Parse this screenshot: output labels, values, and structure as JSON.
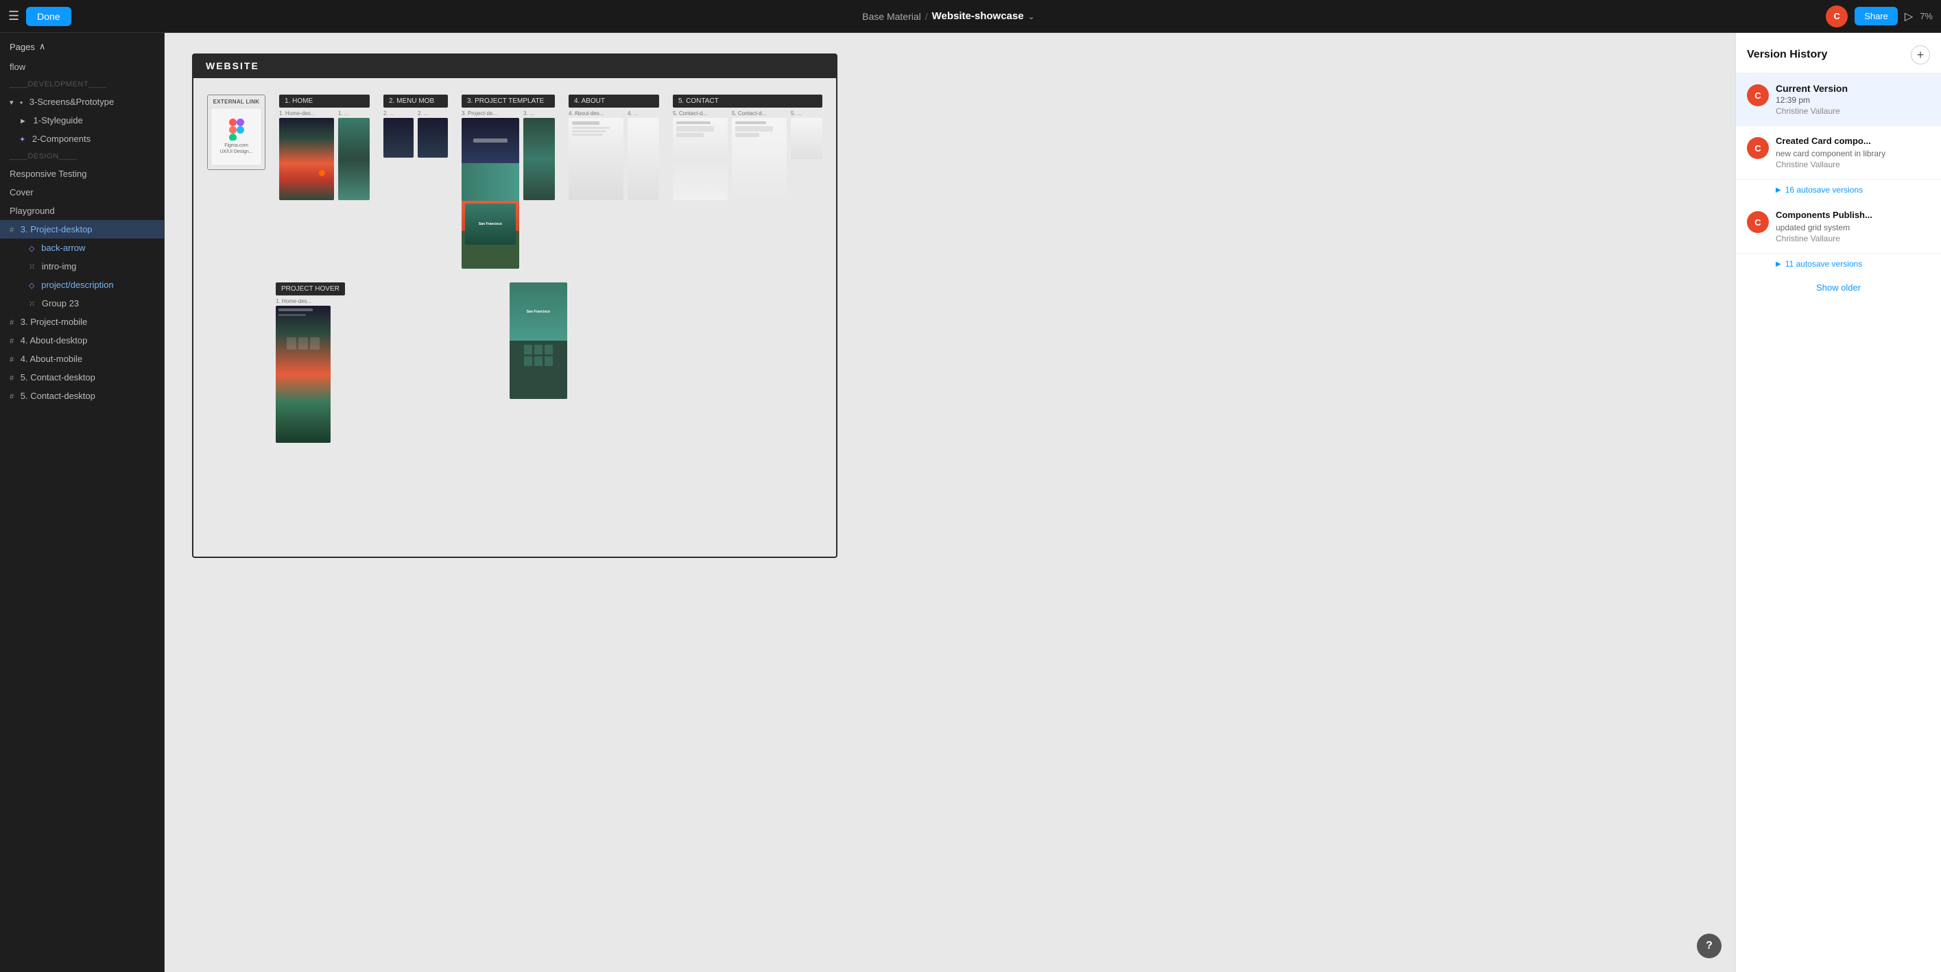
{
  "topbar": {
    "menu_icon": "☰",
    "done_label": "Done",
    "breadcrumb_base": "Base Material",
    "separator": "/",
    "file_name": "Website-showcase",
    "chevron": "⌄",
    "avatar_initials": "C",
    "share_label": "Share",
    "play_icon": "▷",
    "zoom_level": "7%"
  },
  "sidebar": {
    "pages_label": "Pages",
    "pages_chevron": "∧",
    "items": [
      {
        "id": "flow",
        "label": "flow",
        "indent": 0,
        "icon": ""
      },
      {
        "id": "development",
        "label": "____DEVELOPMENT____",
        "indent": 0,
        "icon": "",
        "is_divider": true
      },
      {
        "id": "screens-prototype",
        "label": "3-Screens&Prototype",
        "indent": 0,
        "icon": "▪",
        "expanded": true
      },
      {
        "id": "styleguide",
        "label": "1-Styleguide",
        "indent": 1,
        "icon": "►"
      },
      {
        "id": "components",
        "label": "2-Components",
        "indent": 1,
        "icon": "✦"
      },
      {
        "id": "design",
        "label": "____DESIGN____",
        "indent": 0,
        "icon": "",
        "is_divider": true
      },
      {
        "id": "responsive-testing",
        "label": "Responsive Testing",
        "indent": 0,
        "icon": ""
      },
      {
        "id": "cover",
        "label": "Cover",
        "indent": 0,
        "icon": ""
      },
      {
        "id": "playground",
        "label": "Playground",
        "indent": 0,
        "icon": ""
      },
      {
        "id": "project-desktop",
        "label": "3. Project-desktop",
        "indent": 0,
        "icon": "#",
        "active": true
      },
      {
        "id": "back-arrow",
        "label": "back-arrow",
        "indent": 1,
        "icon": "◇",
        "is_link": true
      },
      {
        "id": "intro-img",
        "label": "intro-img",
        "indent": 1,
        "icon": "⁙"
      },
      {
        "id": "project-description",
        "label": "project/description",
        "indent": 1,
        "icon": "◇",
        "is_link": true
      },
      {
        "id": "group-23",
        "label": "Group 23",
        "indent": 1,
        "icon": "⁙"
      },
      {
        "id": "project-mobile",
        "label": "3. Project-mobile",
        "indent": 0,
        "icon": "#"
      },
      {
        "id": "about-desktop",
        "label": "4. About-desktop",
        "indent": 0,
        "icon": "#"
      },
      {
        "id": "about-mobile",
        "label": "4. About-mobile",
        "indent": 0,
        "icon": "#"
      },
      {
        "id": "contact-desktop",
        "label": "5. Contact-desktop",
        "indent": 0,
        "icon": "#"
      },
      {
        "id": "contact-desktop2",
        "label": "5. Contact-desktop",
        "indent": 0,
        "icon": "#"
      }
    ]
  },
  "canvas": {
    "website_label": "WEBSITE",
    "sections": [
      {
        "id": "home",
        "num": "1.",
        "label": "HOME",
        "sub_items": [
          {
            "label": "1. Home-des...",
            "size": "tall"
          },
          {
            "label": "1. ...",
            "size": "tall-narrow"
          }
        ]
      },
      {
        "id": "menu-mob",
        "num": "2.",
        "label": "MENU MOB",
        "sub_items": [
          {
            "label": "2. ...",
            "size": "menu"
          },
          {
            "label": "2. ...",
            "size": "menu"
          }
        ]
      },
      {
        "id": "project-template",
        "num": "3.",
        "label": "PROJECT TEMPLATE",
        "sub_items": [
          {
            "label": "3. Project-de...",
            "size": "wide-tall"
          },
          {
            "label": "3. ...",
            "size": "tall-narrow"
          }
        ]
      },
      {
        "id": "about",
        "num": "4.",
        "label": "ABOUT",
        "sub_items": [
          {
            "label": "4. About-des...",
            "size": "tall"
          },
          {
            "label": "4. ...",
            "size": "tall-narrow"
          }
        ]
      },
      {
        "id": "contact",
        "num": "5.",
        "label": "CONTACT",
        "sub_items": [
          {
            "label": "5. Contact-d...",
            "size": "tall"
          },
          {
            "label": "5. Contact-d...",
            "size": "tall"
          },
          {
            "label": "5. ...",
            "size": "tall-narrow"
          }
        ]
      }
    ],
    "external_link_label": "EXTERNAL LINK",
    "project_hover_label": "PROJECT HOVER",
    "home_des_label": "Home-des..."
  },
  "version_history": {
    "title": "Version History",
    "add_button": "+",
    "entries": [
      {
        "id": "current",
        "is_current": true,
        "name": "Current Version",
        "time": "12:39 pm",
        "author": "Christine Vallaure",
        "is_active": true
      },
      {
        "id": "card-component",
        "name": "Created Card compo...",
        "description": "new card component in library",
        "author": "Christine Vallaure",
        "autosave_count": "16 autosave versions"
      },
      {
        "id": "components-publish",
        "name": "Components Publish...",
        "description": "updated grid system",
        "author": "Christine Vallaure",
        "autosave_count": "11 autosave versions"
      }
    ],
    "show_older_label": "Show older"
  },
  "help": {
    "icon": "?"
  }
}
